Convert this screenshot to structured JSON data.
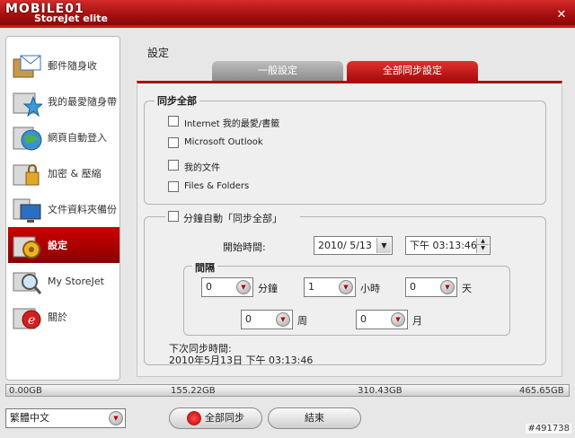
{
  "watermark_logo": "MOBILE01",
  "window": {
    "title": "StoreJet elite",
    "close_icon": "close-icon"
  },
  "sidebar": {
    "items": [
      {
        "label": "郵件隨身收",
        "icon": "mail-icon"
      },
      {
        "label": "我的最愛隨身帶",
        "icon": "favorites-icon"
      },
      {
        "label": "網頁自動登入",
        "icon": "globe-icon"
      },
      {
        "label": "加密 & 壓縮",
        "icon": "lock-folder-icon"
      },
      {
        "label": "文件資料夾備份",
        "icon": "monitor-backup-icon"
      },
      {
        "label": "設定",
        "icon": "gear-folder-icon",
        "active": true
      },
      {
        "label": "My StoreJet",
        "icon": "magnifier-drive-icon"
      },
      {
        "label": "關於",
        "icon": "info-icon"
      }
    ]
  },
  "main": {
    "heading": "設定",
    "tabs": [
      {
        "label": "一般設定"
      },
      {
        "label": "全部同步設定",
        "active": true
      }
    ],
    "sync_all": {
      "title": "同步全部",
      "options": [
        {
          "label": "Internet 我的最愛/書籤",
          "checked": false
        },
        {
          "label": "Microsoft Outlook",
          "checked": false
        },
        {
          "label": "我的文件",
          "checked": false
        },
        {
          "label": "Files & Folders",
          "checked": false
        }
      ]
    },
    "auto_sync": {
      "label": "分鐘自動「同步全部」",
      "checked": false,
      "start_time_label": "開始時間:",
      "date_value": "2010/  5/13",
      "time_value": "下午 03:13:46",
      "interval": {
        "title": "間隔",
        "minutes": {
          "value": "0",
          "unit": "分鐘"
        },
        "hours": {
          "value": "1",
          "unit": "小時"
        },
        "days": {
          "value": "0",
          "unit": "天"
        },
        "weeks": {
          "value": "0",
          "unit": "周"
        },
        "months": {
          "value": "0",
          "unit": "月"
        }
      },
      "next_sync_label": "下次同步時間:",
      "next_sync_value": "2010年5月13日 下午 03:13:46"
    }
  },
  "capacity": {
    "marks": [
      "0.00GB",
      "155.22GB",
      "310.43GB",
      "465.65GB"
    ],
    "used_fraction": 0.0
  },
  "footer": {
    "language": "繁體中文",
    "sync_all_button": "全部同步",
    "exit_button": "結束"
  },
  "watermark": "#491738",
  "colors": {
    "accent": "#b10c0c",
    "panel": "#efefef",
    "window": "#e7e7e7"
  }
}
